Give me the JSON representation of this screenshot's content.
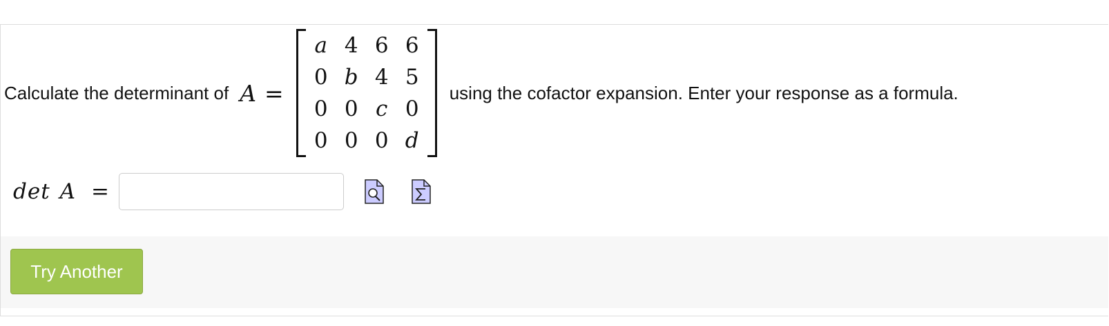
{
  "problem": {
    "text_before": "Calculate the determinant of",
    "matrix_symbol": "A",
    "equals": "=",
    "text_after": "using the cofactor expansion. Enter your response as a formula.",
    "matrix": [
      [
        "a",
        "4",
        "6",
        "6"
      ],
      [
        "0",
        "b",
        "4",
        "5"
      ],
      [
        "0",
        "0",
        "c",
        "0"
      ],
      [
        "0",
        "0",
        "0",
        "d"
      ]
    ]
  },
  "answer": {
    "label_det": "det",
    "label_symbol": "A",
    "equals": "=",
    "value": "",
    "placeholder": ""
  },
  "icons": {
    "preview": "preview-document-icon",
    "equation": "equation-editor-icon",
    "icon_fill": "#ccccff"
  },
  "footer": {
    "try_another_label": "Try Another",
    "button_color": "#9fc54f"
  }
}
